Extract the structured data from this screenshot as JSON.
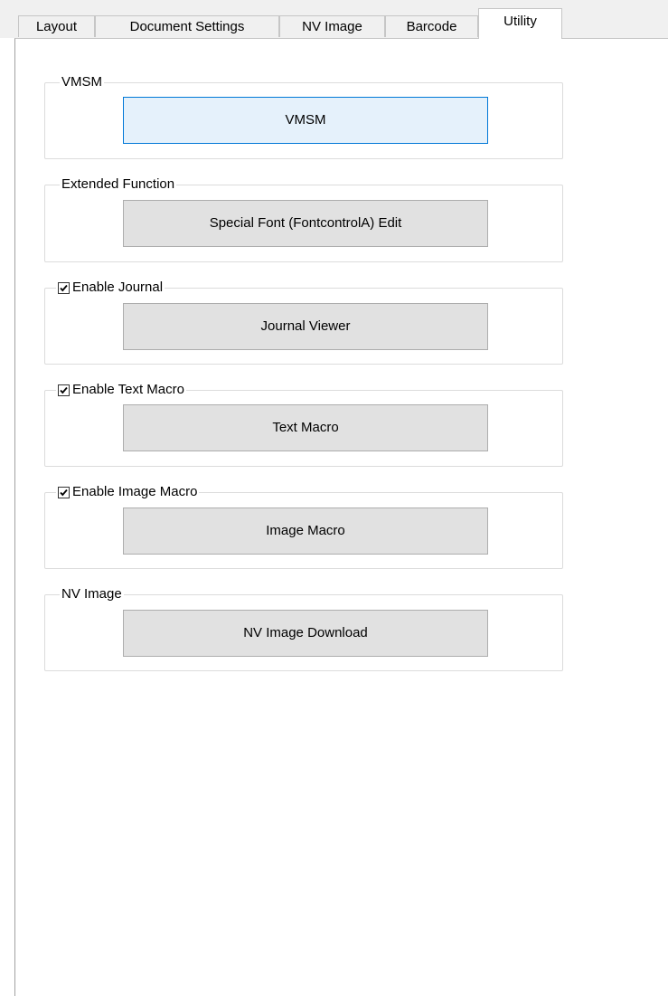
{
  "tabs": [
    {
      "label": "Layout"
    },
    {
      "label": "Document Settings"
    },
    {
      "label": "NV Image"
    },
    {
      "label": "Barcode"
    },
    {
      "label": "Utility"
    }
  ],
  "active_tab": "Utility",
  "groups": {
    "vmsm": {
      "title": "VMSM",
      "button_label": "VMSM"
    },
    "extended": {
      "title": "Extended Function",
      "button_label": "Special Font (FontcontrolA) Edit"
    },
    "journal": {
      "checkbox_label": "Enable Journal",
      "checked": true,
      "button_label": "Journal Viewer"
    },
    "text_macro": {
      "checkbox_label": "Enable Text Macro",
      "checked": true,
      "button_label": "Text Macro"
    },
    "image_macro": {
      "checkbox_label": "Enable Image Macro",
      "checked": true,
      "button_label": "Image Macro"
    },
    "nv_image": {
      "title": "NV Image",
      "button_label": "NV Image Download"
    }
  },
  "colors": {
    "focus_border": "#0078d7",
    "button_face": "#e1e1e1",
    "group_border": "#dcdcdc"
  }
}
